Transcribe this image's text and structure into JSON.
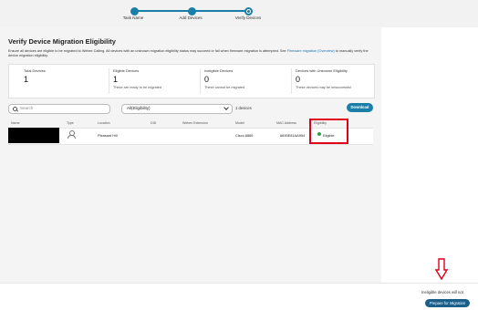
{
  "stepper": {
    "steps": [
      {
        "label": "Task Name",
        "state": "done"
      },
      {
        "label": "Add Devices",
        "state": "done"
      },
      {
        "label": "Verify Devices",
        "state": "current"
      }
    ]
  },
  "page": {
    "title": "Verify Device Migration Eligibility",
    "description": "Ensure all devices are eligible to be migrated to Webex Calling. All devices with an unknown migration eligibility status may succeed or fail when firmware migration is attempted. See",
    "description_link": "Firmware migration (Overview)",
    "description_tail": "to manually verify the device migration eligibility."
  },
  "summary": {
    "stats": [
      {
        "label": "Total Devices",
        "value": "1",
        "sub": ""
      },
      {
        "label": "Eligible Devices",
        "value": "1",
        "sub": "These are ready to be migrated"
      },
      {
        "label": "Ineligible Devices",
        "value": "0",
        "sub": "These cannot be migrated"
      },
      {
        "label": "Devices with Unknown Eligibility",
        "value": "0",
        "sub": "These devices may be unsuccessful"
      }
    ]
  },
  "filters": {
    "search_placeholder": "Search",
    "eligibility_select": "All(Eligibility)",
    "device_count": "1 devices",
    "download_label": "Download"
  },
  "table": {
    "headers": [
      "Name",
      "Type",
      "Location",
      "DID",
      "Webex Extension",
      "Model",
      "MAC Address",
      "Eligibility"
    ],
    "rows": [
      {
        "name": "",
        "location": "Pleasant Hill",
        "did": "",
        "extension": "",
        "model": "Cisco 8865",
        "mac": "6690E81AA954",
        "eligibility": "Eligible"
      }
    ]
  },
  "footer": {
    "notice": "Ineligible devices will not",
    "prepare_label": "Prepare for Migration"
  },
  "colors": {
    "accent": "#1a7fa8",
    "highlight": "#e1001a",
    "eligible": "#2aa14b"
  }
}
